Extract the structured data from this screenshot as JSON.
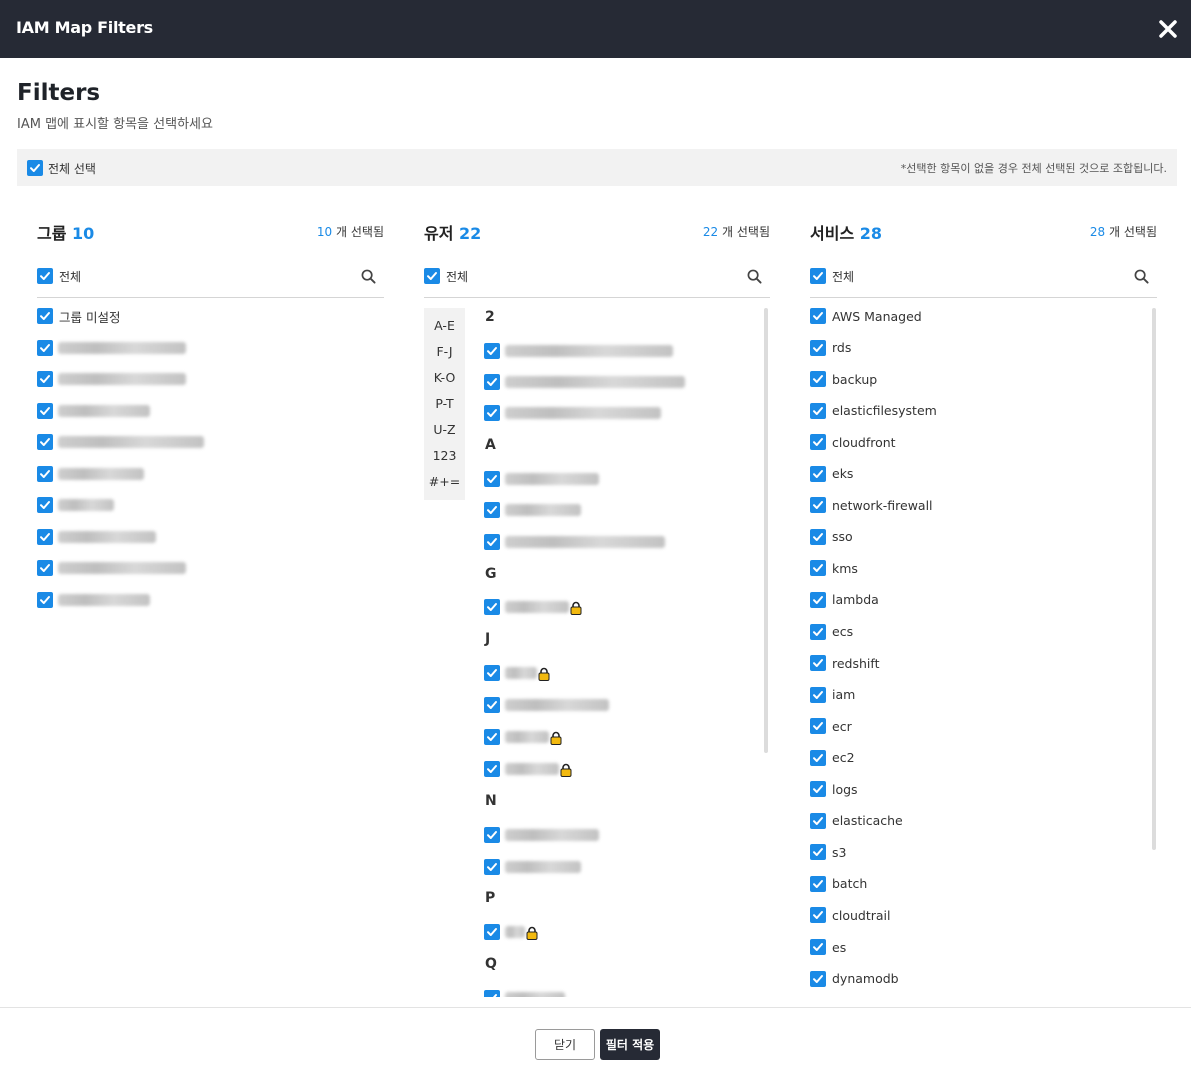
{
  "window": {
    "title": "IAM Map Filters"
  },
  "header": {
    "title": "Filters",
    "subtitle": "IAM 맵에 표시할 항목을 선택하세요"
  },
  "select_all": {
    "label": "전체 선택",
    "note": "*선택한 항목이 없을 경우 전체 선택된 것으로 조합됩니다."
  },
  "groups": {
    "title": "그룹",
    "total": "10",
    "selected": "10",
    "selected_suffix": " 개 선택됨",
    "all_label": "전체",
    "items": [
      "그룹 미설정"
    ]
  },
  "users": {
    "title": "유저",
    "total": "22",
    "selected": "22",
    "selected_suffix": " 개 선택됨",
    "all_label": "전체",
    "index": [
      "A-E",
      "F-J",
      "K-O",
      "P-T",
      "U-Z",
      "123",
      "#+="
    ],
    "letters": [
      "2",
      "A",
      "G",
      "J",
      "N",
      "P",
      "Q"
    ]
  },
  "services": {
    "title": "서비스",
    "total": "28",
    "selected": "28",
    "selected_suffix": " 개 선택됨",
    "all_label": "전체",
    "items": [
      "AWS Managed",
      "rds",
      "backup",
      "elasticfilesystem",
      "cloudfront",
      "eks",
      "network-firewall",
      "sso",
      "kms",
      "lambda",
      "ecs",
      "redshift",
      "iam",
      "ecr",
      "ec2",
      "logs",
      "elasticache",
      "s3",
      "batch",
      "cloudtrail",
      "es",
      "dynamodb"
    ]
  },
  "footer": {
    "close_label": "닫기",
    "apply_label": "필터 적용"
  },
  "colors": {
    "accent": "#1a8ae6",
    "topbar": "#262a35",
    "lock": "#f2b90f"
  }
}
